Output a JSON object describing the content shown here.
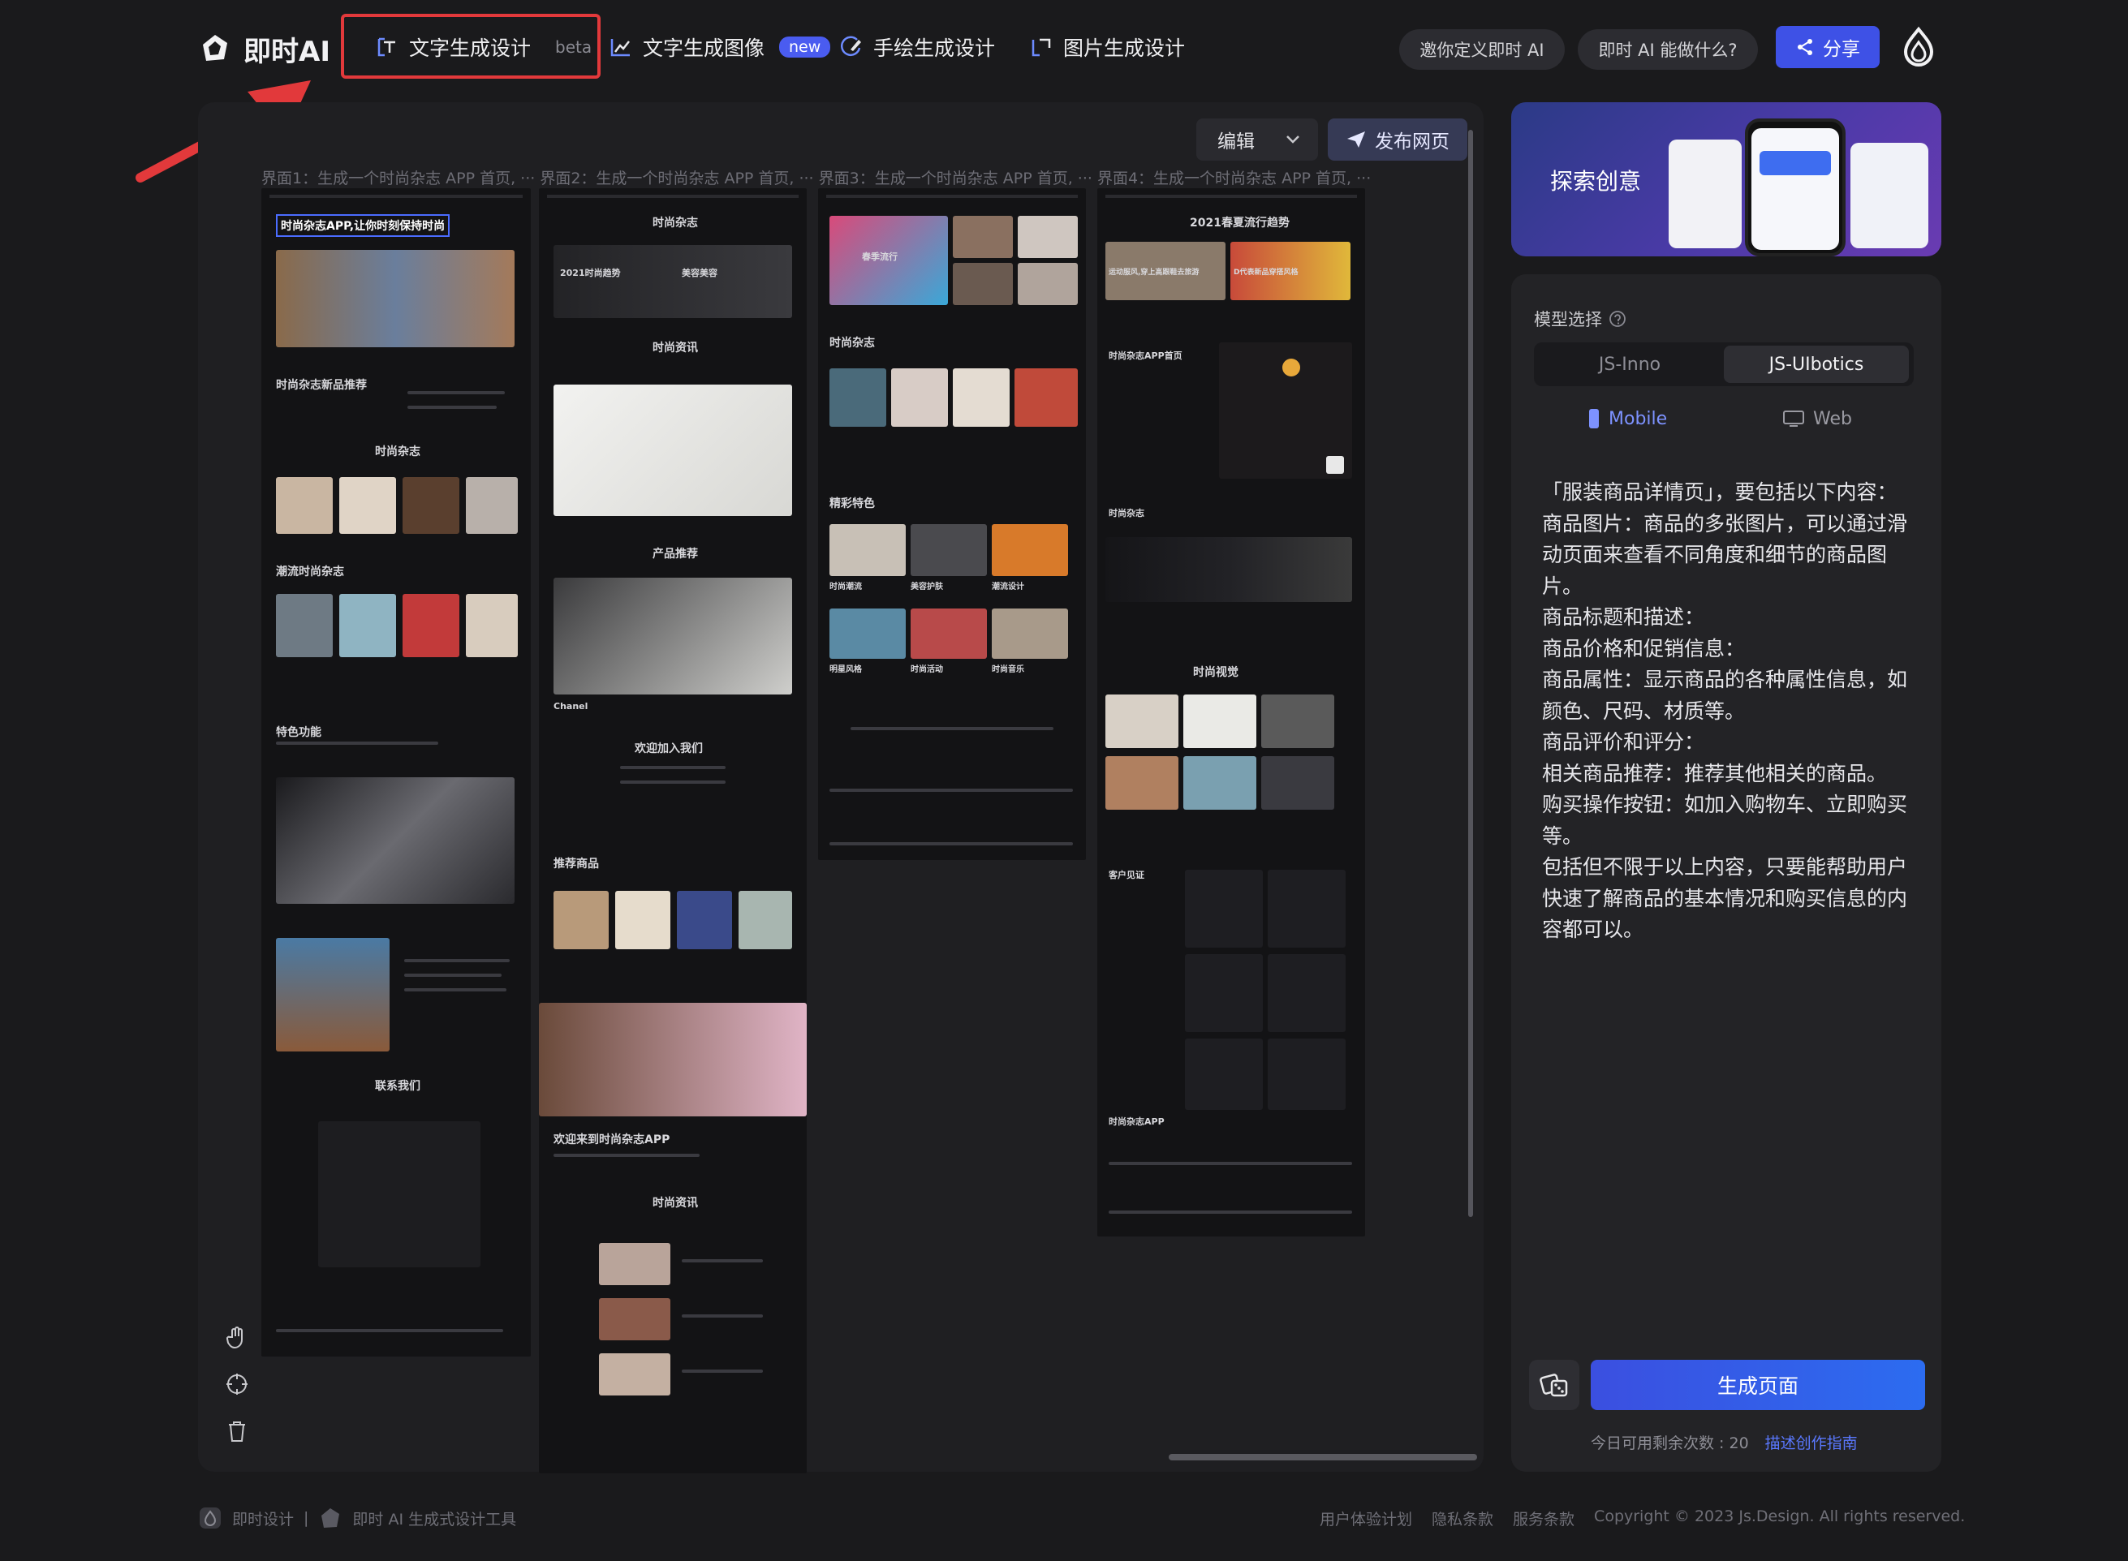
{
  "app": {
    "logo_text": "即时AI"
  },
  "nav": {
    "items": [
      {
        "label": "文字生成设计",
        "badge": "beta",
        "icon": "text-design-icon"
      },
      {
        "label": "文字生成图像",
        "badge": "new",
        "icon": "image-chart-icon"
      },
      {
        "label": "手绘生成设计",
        "icon": "sketch-icon"
      },
      {
        "label": "图片生成设计",
        "icon": "image-design-icon"
      }
    ],
    "invite_label": "邀你定义即时 AI",
    "what_label": "即时 AI 能做什么?",
    "share_label": "分享"
  },
  "canvas": {
    "edit_label": "编辑",
    "publish_label": "发布网页",
    "screens_caption": "界面1：生成一个时尚杂志 APP 首页, ··· 界面2：生成一个时尚杂志 APP 首页, ··· 界面3：生成一个时尚杂志 APP 首页, ··· 界面4：生成一个时尚杂志 APP 首页, ···",
    "screen1": {
      "headline": "时尚杂志APP,让你时刻保持时尚",
      "section1": "时尚杂志新品推荐",
      "section2": "时尚杂志",
      "section3": "潮流时尚杂志",
      "section4": "特色功能",
      "section5": "联系我们"
    },
    "screen2": {
      "title": "时尚杂志",
      "card1": "2021时尚趋势",
      "card2": "美容美容",
      "section1": "时尚资讯",
      "section2": "产品推荐",
      "caption1": "Chanel",
      "section3": "欢迎加入我们",
      "section4": "推荐商品",
      "section5": "欢迎来到时尚杂志APP",
      "section6": "时尚资讯"
    },
    "screen3": {
      "tag": "春季流行",
      "section1": "时尚杂志",
      "section2": "精彩特色",
      "labels": [
        "时尚潮流",
        "美容护肤",
        "潮流设计",
        "明星风格",
        "时尚活动",
        "时尚音乐"
      ]
    },
    "screen4": {
      "title": "2021春夏流行趋势",
      "caption1": "运动服风,穿上高跟鞋去旅游",
      "caption2": "D代表新品穿搭风格",
      "section1": "时尚杂志APP首页",
      "section2": "时尚杂志",
      "section3": "时尚视觉",
      "section4": "客户见证",
      "section5": "时尚杂志APP"
    }
  },
  "sidebar": {
    "banner_text": "探索创意",
    "model_label": "模型选择",
    "models": [
      "JS-Inno",
      "JS-UIbotics"
    ],
    "selected_model": "JS-UIbotics",
    "devices": [
      "Mobile",
      "Web"
    ],
    "selected_device": "Mobile",
    "prompt_lines": [
      "「服装商品详情页」，要包括以下内容：",
      "商品图片：商品的多张图片，可以通过滑动页面来查看不同角度和细节的商品图片。",
      "商品标题和描述：",
      "商品价格和促销信息：",
      "商品属性：显示商品的各种属性信息，如颜色、尺码、材质等。",
      "商品评价和评分：",
      "相关商品推荐：推荐其他相关的商品。",
      "购买操作按钮：如加入购物车、立即购买等。",
      "包括但不限于以上内容，只要能帮助用户快速了解商品的基本情况和购买信息的内容都可以。"
    ],
    "generate_label": "生成页面",
    "quota_text": "今日可用剩余次数 : 20",
    "guide_link": "描述创作指南"
  },
  "footer": {
    "brand1": "即时设计",
    "separator": "|",
    "brand2": "即时 AI 生成式设计工具",
    "links": [
      "用户体验计划",
      "隐私条款",
      "服务条款"
    ],
    "copyright": "Copyright © 2023 Js.Design. All rights reserved."
  },
  "colors": {
    "accent": "#3e51e6",
    "highlight_box": "#e2393b",
    "background": "#1a1a1c"
  }
}
